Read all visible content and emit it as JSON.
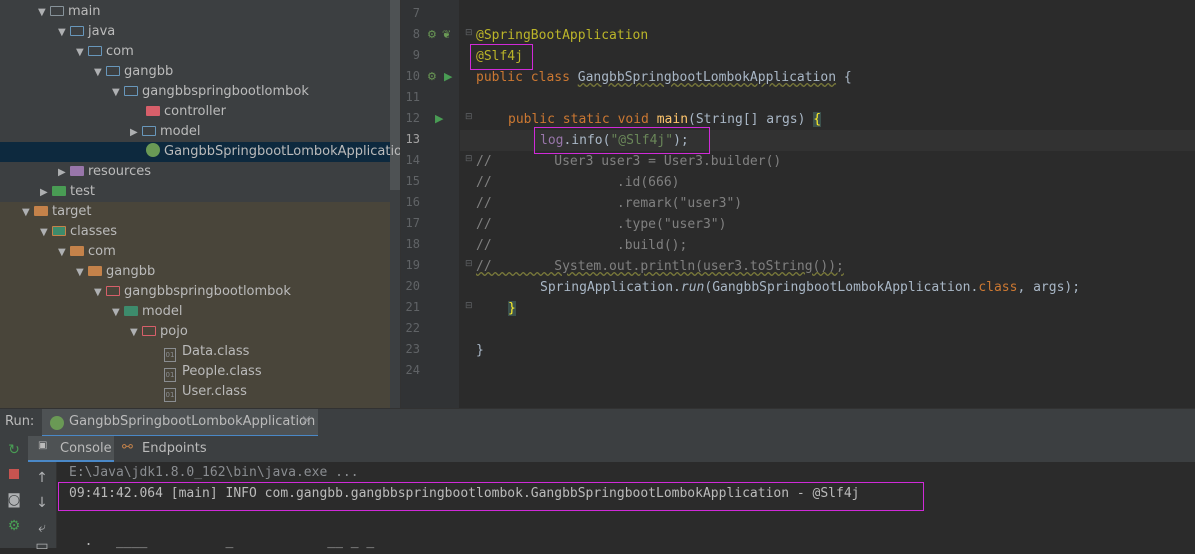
{
  "project_tree": {
    "items": [
      {
        "label": "main",
        "icon": "folder-icon"
      },
      {
        "label": "java",
        "icon": "source-folder-icon"
      },
      {
        "label": "com",
        "icon": "package-icon"
      },
      {
        "label": "gangbb",
        "icon": "package-icon"
      },
      {
        "label": "gangbbspringbootlombok",
        "icon": "package-icon"
      },
      {
        "label": "controller",
        "icon": "controller-package-icon"
      },
      {
        "label": "model",
        "icon": "package-icon"
      },
      {
        "label": "GangbbSpringbootLombokApplication",
        "icon": "spring-boot-class-icon"
      },
      {
        "label": "resources",
        "icon": "resources-folder-icon"
      },
      {
        "label": "test",
        "icon": "test-folder-icon"
      },
      {
        "label": "target",
        "icon": "excluded-folder-icon"
      },
      {
        "label": "classes",
        "icon": "classes-folder-icon"
      },
      {
        "label": "com",
        "icon": "excluded-folder-icon"
      },
      {
        "label": "gangbb",
        "icon": "excluded-folder-icon"
      },
      {
        "label": "gangbbspringbootlombok",
        "icon": "package-folder-icon"
      },
      {
        "label": "model",
        "icon": "package-icon"
      },
      {
        "label": "pojo",
        "icon": "package-folder-icon"
      },
      {
        "label": "Data.class",
        "icon": "class-file-icon"
      },
      {
        "label": "People.class",
        "icon": "class-file-icon"
      },
      {
        "label": "User.class",
        "icon": "class-file-icon"
      }
    ]
  },
  "editor": {
    "line_numbers": [
      "7",
      "8",
      "9",
      "10",
      "11",
      "12",
      "13",
      "14",
      "15",
      "16",
      "17",
      "18",
      "19",
      "20",
      "21",
      "22",
      "23",
      "24"
    ],
    "current_line": "13",
    "lines": {
      "l8": "@SpringBootApplication",
      "l9": "@Slf4j",
      "l10_kw": "public class ",
      "l10_cls": "GangbbSpringbootLombokApplication",
      "l10_end": " {",
      "l12_kw": "public static void ",
      "l12_fn": "main",
      "l12_args": "(String[] args) ",
      "l12_brace": "{",
      "l13_log": "log",
      "l13_info": ".info(",
      "l13_str": "\"@Slf4j\"",
      "l13_end": ");",
      "l14": "//        User3 user3 = User3.builder()",
      "l15": "//                .id(666)",
      "l16": "//                .remark(\"user3\")",
      "l17": "//                .type(\"user3\")",
      "l18": "//                .build();",
      "l19": "//        System.out.println(user3.toString());",
      "l20_a": "SpringApplication.",
      "l20_run": "run",
      "l20_b": "(GangbbSpringbootLombokApplication.",
      "l20_kw": "class",
      "l20_c": ", args);",
      "l21": "}",
      "l23": "}"
    }
  },
  "run_panel": {
    "label": "Run:",
    "tab": "GangbbSpringbootLombokApplication",
    "close": "×",
    "tabs": [
      "Console",
      "Endpoints"
    ],
    "console_lines": [
      "E:\\Java\\jdk1.8.0_162\\bin\\java.exe ...",
      "09:41:42.064 [main] INFO com.gangbb.gangbbspringbootlombok.GangbbSpringbootLombokApplication - @Slf4j",
      "  .   ____          _            __ _ _"
    ]
  },
  "colors": {
    "highlight": "#d02ad9",
    "annotation": "#bbb529",
    "keyword": "#cc7832",
    "string": "#6a8759"
  }
}
